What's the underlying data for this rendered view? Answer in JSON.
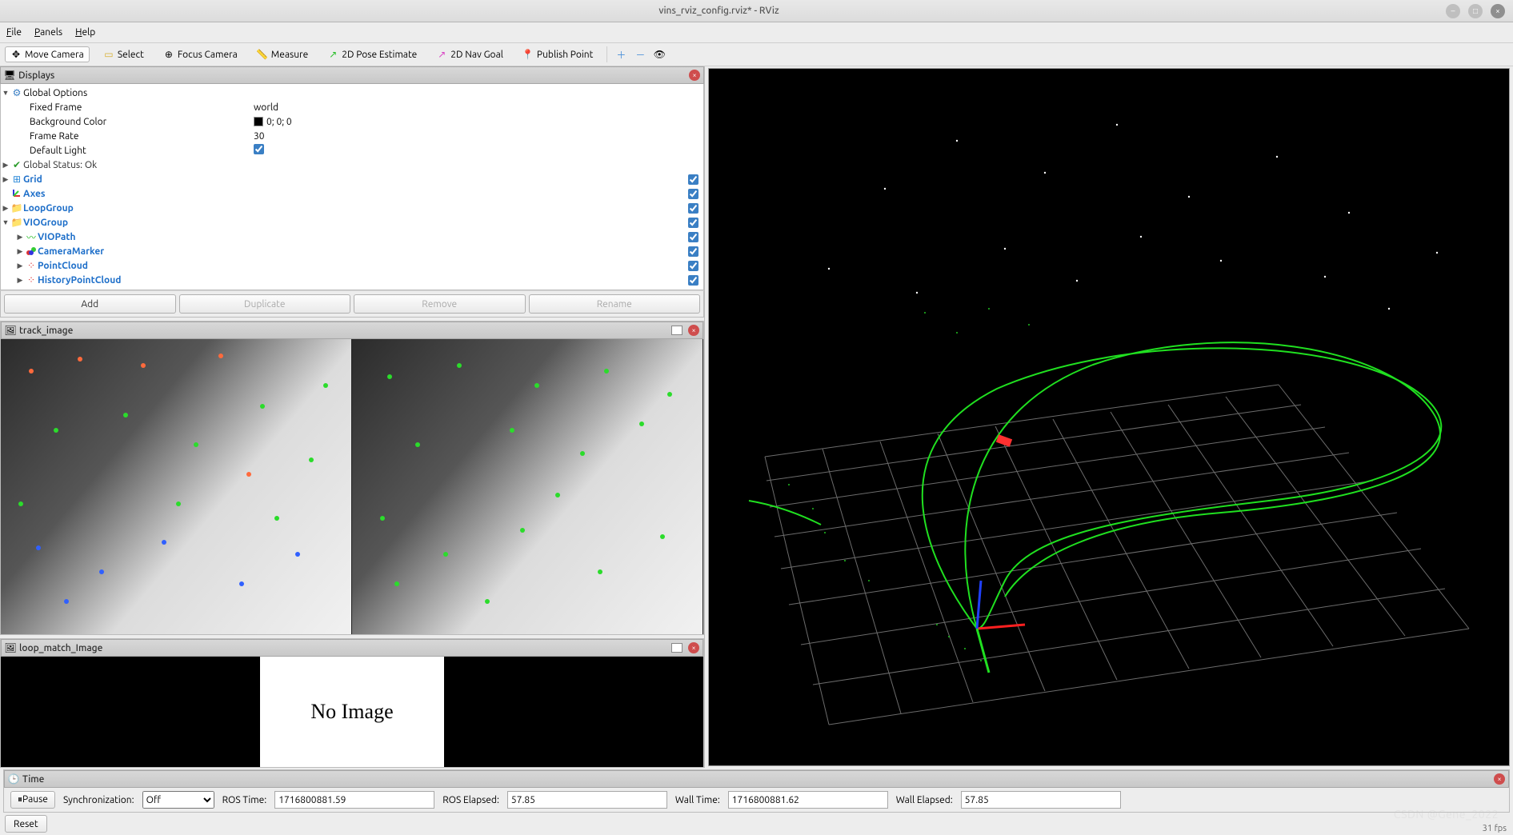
{
  "window": {
    "title": "vins_rviz_config.rviz* - RViz"
  },
  "menus": {
    "file": "File",
    "panels": "Panels",
    "help": "Help"
  },
  "tools": {
    "move": "Move Camera",
    "select": "Select",
    "focus": "Focus Camera",
    "measure": "Measure",
    "pose": "2D Pose Estimate",
    "nav": "2D Nav Goal",
    "publish": "Publish Point"
  },
  "displays": {
    "title": "Displays",
    "global_options": "Global Options",
    "props": {
      "fixed_frame_label": "Fixed Frame",
      "fixed_frame_value": "world",
      "bg_label": "Background Color",
      "bg_value": "0; 0; 0",
      "framerate_label": "Frame Rate",
      "framerate_value": "30",
      "default_light_label": "Default Light"
    },
    "global_status": "Global Status: Ok",
    "items": {
      "grid": "Grid",
      "axes": "Axes",
      "loopgroup": "LoopGroup",
      "viogroup": "VIOGroup",
      "viopath": "VIOPath",
      "cameramarker": "CameraMarker",
      "pointcloud": "PointCloud",
      "historypointcloud": "HistoryPointCloud"
    },
    "buttons": {
      "add": "Add",
      "duplicate": "Duplicate",
      "remove": "Remove",
      "rename": "Rename"
    }
  },
  "track_panel": {
    "title": "track_image"
  },
  "loop_panel": {
    "title": "loop_match_Image",
    "noimage": "No Image"
  },
  "time": {
    "title": "Time",
    "pause": "Pause",
    "sync_label": "Synchronization:",
    "sync_value": "Off",
    "ros_time_label": "ROS Time:",
    "ros_time_value": "1716800881.59",
    "ros_elapsed_label": "ROS Elapsed:",
    "ros_elapsed_value": "57.85",
    "wall_time_label": "Wall Time:",
    "wall_time_value": "1716800881.62",
    "wall_elapsed_label": "Wall Elapsed:",
    "wall_elapsed_value": "57.85"
  },
  "reset": "Reset",
  "fps": "31 fps",
  "watermark": "CSDN @Gene_2022"
}
